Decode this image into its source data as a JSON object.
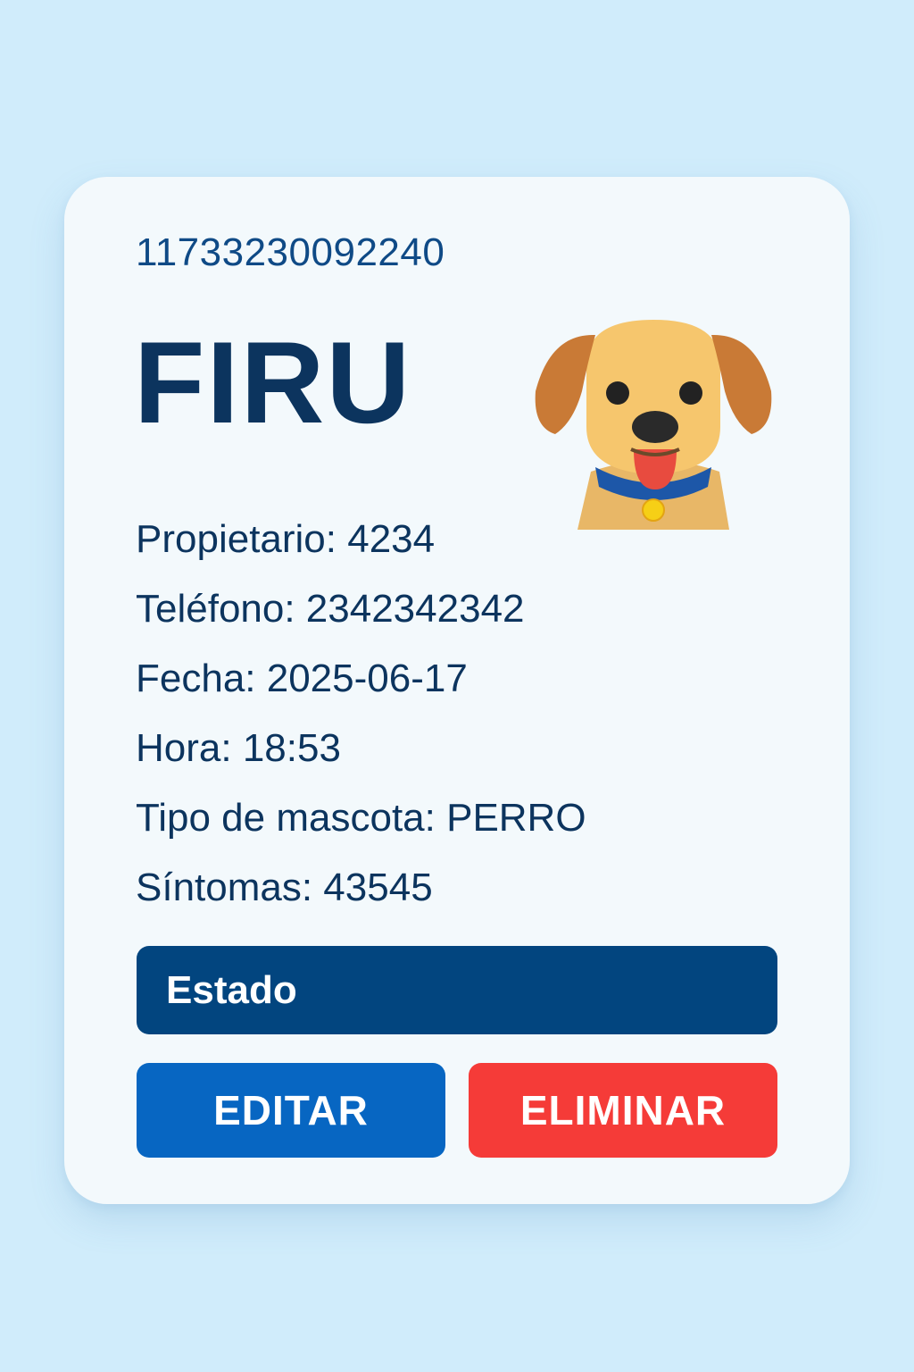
{
  "card": {
    "record_id": "11733230092240",
    "pet_name": "FIRU",
    "illustration": "dog-face-icon",
    "details": [
      "Propietario: 4234",
      "Teléfono: 2342342342",
      "Fecha: 2025-06-17",
      "Hora: 18:53",
      "Tipo de mascota: PERRO",
      "Síntomas: 43545"
    ],
    "status_label": "Estado",
    "edit_label": "EDITAR",
    "delete_label": "ELIMINAR"
  },
  "colors": {
    "background": "#d0ecfb",
    "card": "#f3f9fc",
    "text_dark": "#0c345e",
    "status_bar": "#02457f",
    "edit_button": "#0766c2",
    "delete_button": "#f53b38"
  }
}
